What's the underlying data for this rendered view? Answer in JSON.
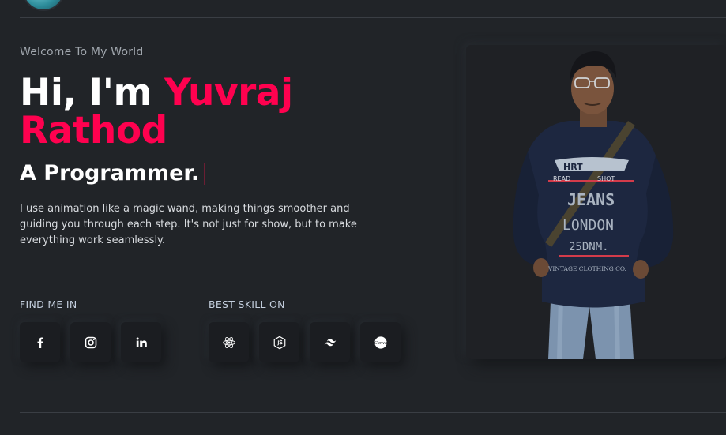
{
  "hero": {
    "welcome": "Welcome To My World",
    "greeting": "Hi, I'm ",
    "name": "Yuvraj Rathod",
    "role": "A Programmer.",
    "description": "I use animation like a magic wand, making things smoother and guiding you through each step. It's not just for show, but to make everything work seamlessly."
  },
  "social": {
    "label": "FIND ME IN",
    "icons": [
      "facebook-icon",
      "instagram-icon",
      "linkedin-icon"
    ]
  },
  "skills": {
    "label": "BEST SKILL ON",
    "icons": [
      "react-icon",
      "nodejs-icon",
      "tailwind-icon",
      "canva-icon"
    ]
  },
  "photo": {
    "shirt_text": [
      "HRT",
      "READ",
      "SHOT",
      "JEANS",
      "LONDON",
      "25DNM.",
      "VINTAGE CLOTHING CO."
    ]
  },
  "colors": {
    "background": "#212428",
    "accent": "#ff014f",
    "text": "#ffffff",
    "muted": "#a0a6ad"
  }
}
